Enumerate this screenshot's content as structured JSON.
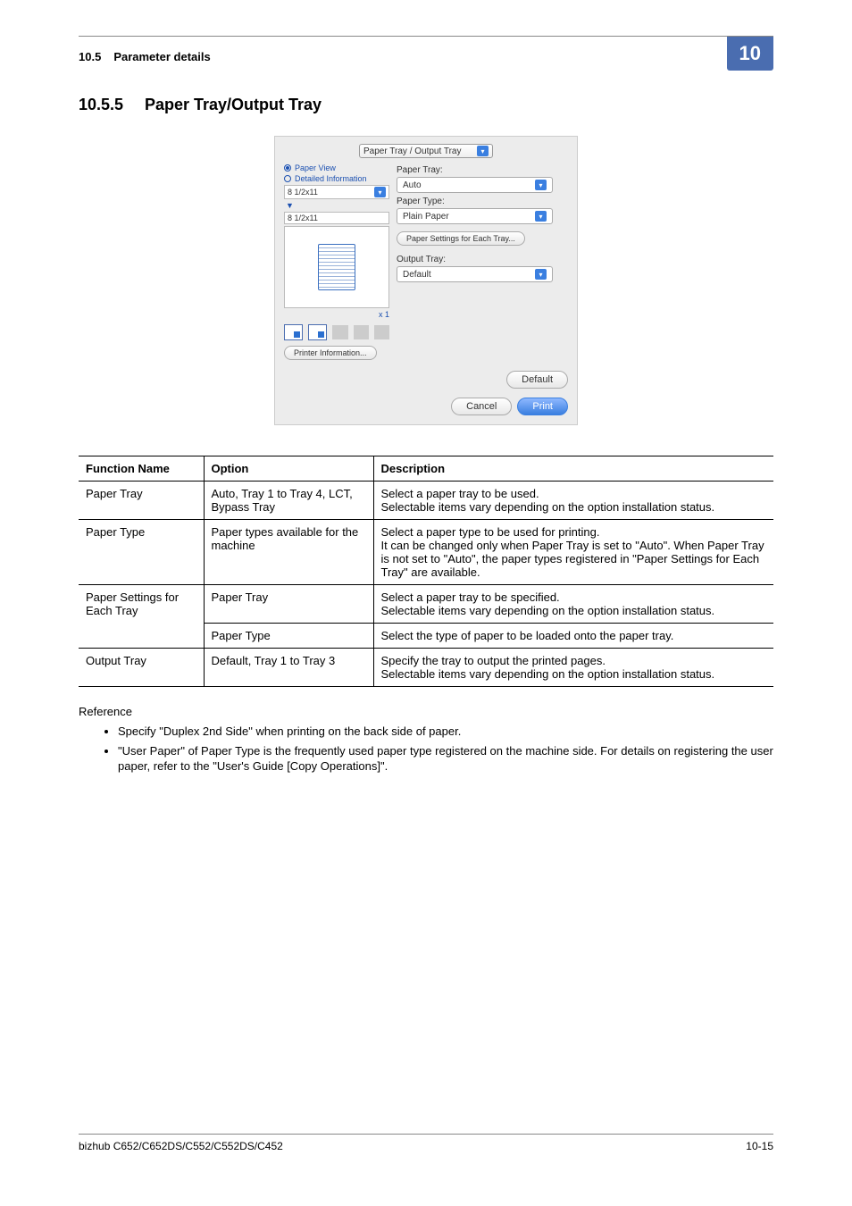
{
  "header": {
    "section_no": "10.5",
    "section_title": "Parameter details",
    "chapter_no": "10"
  },
  "section": {
    "number": "10.5.5",
    "title": "Paper Tray/Output Tray"
  },
  "dialog": {
    "dropdown_title": "Paper Tray / Output Tray",
    "radio_paper_view": "Paper View",
    "radio_detailed": "Detailed Information",
    "size_field_1": "8 1/2x11",
    "size_field_2": "8 1/2x11",
    "x1": "x 1",
    "printer_info_btn": "Printer Information...",
    "paper_tray_label": "Paper Tray:",
    "paper_tray_value": "Auto",
    "paper_type_label": "Paper Type:",
    "paper_type_value": "Plain Paper",
    "each_tray_btn": "Paper Settings for Each Tray...",
    "output_tray_label": "Output Tray:",
    "output_tray_value": "Default",
    "default_btn": "Default",
    "cancel_btn": "Cancel",
    "print_btn": "Print"
  },
  "table": {
    "headers": {
      "c1": "Function Name",
      "c2": "Option",
      "c3": "Description"
    },
    "rows": [
      {
        "fn": "Paper Tray",
        "opt": "Auto, Tray 1 to Tray 4, LCT, Bypass Tray",
        "desc": "Select a paper tray to be used.\nSelectable items vary depending on the option installation status."
      },
      {
        "fn": "Paper Type",
        "opt": "Paper types available for the machine",
        "desc": "Select a paper type to be used for printing.\nIt can be changed only when Paper Tray is set to \"Auto\". When Paper Tray is not set to \"Auto\", the paper types registered in \"Paper Settings for Each Tray\" are available."
      },
      {
        "fn": "Paper Settings for Each Tray",
        "sub": [
          {
            "opt": "Paper Tray",
            "desc": "Select a paper tray to be specified.\nSelectable items vary depending on the option installation status."
          },
          {
            "opt": "Paper Type",
            "desc": "Select the type of paper to be loaded onto the paper tray."
          }
        ]
      },
      {
        "fn": "Output Tray",
        "opt": "Default, Tray 1 to Tray 3",
        "desc": "Specify the tray to output the printed pages.\nSelectable items vary depending on the option installation status."
      }
    ]
  },
  "reference": {
    "title": "Reference",
    "items": [
      "Specify \"Duplex 2nd Side\" when printing on the back side of paper.",
      "\"User Paper\" of Paper Type is the frequently used paper type registered on the machine side. For details on registering the user paper, refer to the \"User's Guide [Copy Operations]\"."
    ]
  },
  "footer": {
    "left": "bizhub C652/C652DS/C552/C552DS/C452",
    "right": "10-15"
  }
}
